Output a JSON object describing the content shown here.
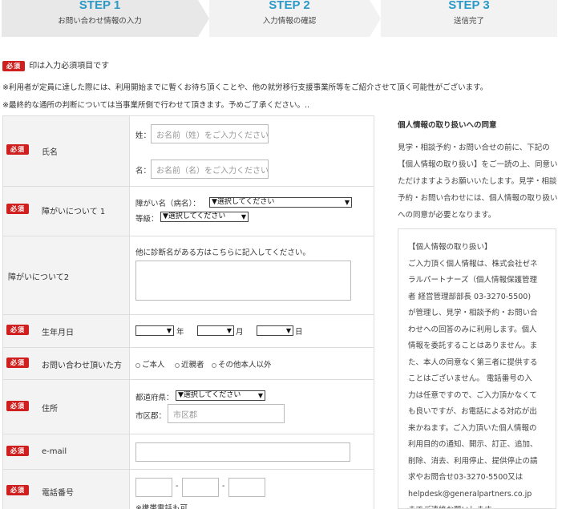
{
  "steps": [
    {
      "num": "STEP 1",
      "label": "お問い合わせ情報の入力"
    },
    {
      "num": "STEP 2",
      "label": "入力情報の確認"
    },
    {
      "num": "STEP 3",
      "label": "送信完了"
    }
  ],
  "required_badge": "必須",
  "required_note": "印は入力必須項目です",
  "notes": [
    "※利用者が定員に達した際には、利用開始までに暫くお待ち頂くことや、他の就労移行支援事業所等をご紹介させて頂く可能性がございます。",
    "※最終的な通所の判断については当事業所側で行わせて頂きます。予めご了承ください。.."
  ],
  "form": {
    "name": {
      "label": "氏名",
      "last_prefix": "姓：",
      "last_placeholder": "お名前（姓）をご入力ください",
      "first_prefix": "名：",
      "first_placeholder": "お名前（名）をご入力ください"
    },
    "disability1": {
      "label": "障がいについて 1",
      "name_prefix": "障がい名（病名）：",
      "name_select": "▼選択してください",
      "grade_prefix": "等級：",
      "grade_select": "▼選択してください"
    },
    "disability2": {
      "label": "障がいについて2",
      "hint": "他に診断名がある方はこちらに記入してください。"
    },
    "birth": {
      "label": "生年月日",
      "year": "年",
      "month": "月",
      "day": "日"
    },
    "inquirer": {
      "label": "お問い合わせ頂いた方",
      "options": [
        "ご本人",
        "近親者",
        "その他本人以外"
      ]
    },
    "address": {
      "label": "住所",
      "pref_prefix": "都道府県：",
      "pref_select": "▼選択してください",
      "city_prefix": "市区郡：",
      "city_placeholder": "市区郡"
    },
    "email": {
      "label": "e-mail"
    },
    "phone": {
      "label": "電話番号",
      "dash": "-",
      "note": "※携帯電話も可"
    }
  },
  "privacy": {
    "title": "個人情報の取り扱いへの同意",
    "intro": "見学・相談予約・お問い合せの前に、下記の【個人情報の取り扱い】をご一読の上、同意いただけますようお願いいたします。見学・相談予約・お問い合わせには、個人情報の取り扱いへの同意が必要となります。",
    "box_lines": [
      "【個人情報の取り扱い】",
      "ご入力頂く個人情報は、株式会社ゼネ",
      "ラルパートナーズ（個人情報保護管理",
      "者 経営管理部部長 03-3270-5500)",
      "が管理し、見学・相談予約・お問い合",
      "わせへの回答のみに利用します。個人",
      "情報を委託することはありません。ま",
      "た、本人の同意なく第三者に提供する",
      "ことはございません。 電話番号の入",
      "力は任意ですので、ご入力頂かなくて",
      "も良いですが、お電話による対応が出",
      "来かねます。ご入力頂いた個人情報の",
      "利用目的の通知、開示、訂正、追加、",
      "削除、消去、利用停止、提供停止の請",
      "求やお問合せ03-3270-5500又は",
      "helpdesk@generalpartners.co.jp",
      "までご連絡お願いします。"
    ]
  }
}
